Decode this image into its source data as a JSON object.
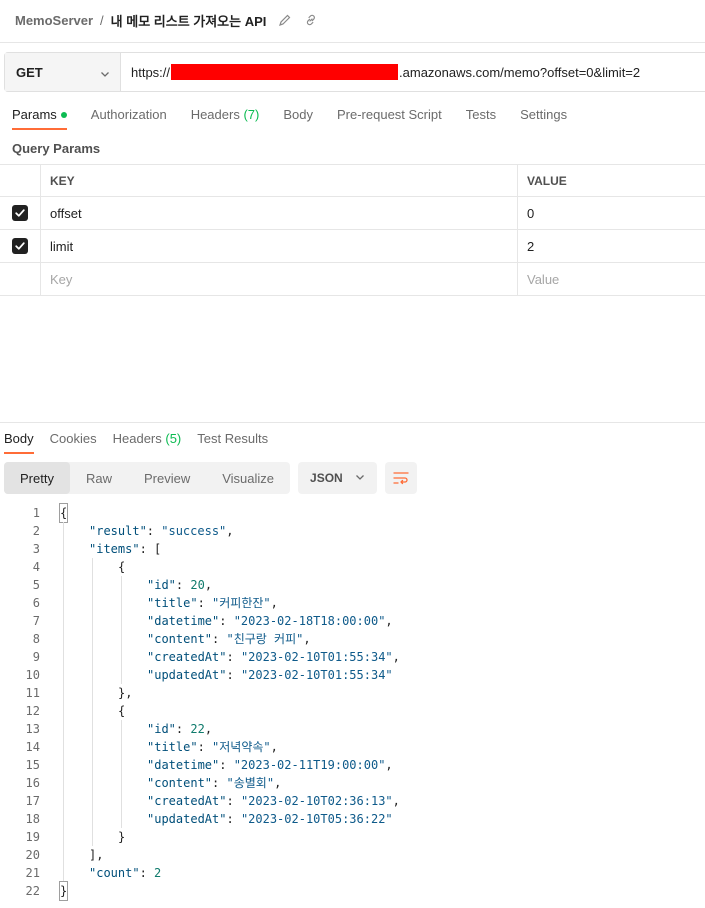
{
  "breadcrumb": {
    "collection": "MemoServer",
    "separator": "/",
    "request": "내 메모 리스트 가져오는 API"
  },
  "request": {
    "method": "GET",
    "url_prefix": "https://",
    "url_suffix": ".amazonaws.com/memo?offset=0&limit=2"
  },
  "request_tabs": [
    {
      "name": "params",
      "label": "Params",
      "count": "",
      "dot": true,
      "active": true
    },
    {
      "name": "authorization",
      "label": "Authorization",
      "count": "",
      "dot": false,
      "active": false
    },
    {
      "name": "headers",
      "label": "Headers",
      "count": "(7)",
      "dot": false,
      "active": false
    },
    {
      "name": "body",
      "label": "Body",
      "count": "",
      "dot": false,
      "active": false
    },
    {
      "name": "pre-request-script",
      "label": "Pre-request Script",
      "count": "",
      "dot": false,
      "active": false
    },
    {
      "name": "tests",
      "label": "Tests",
      "count": "",
      "dot": false,
      "active": false
    },
    {
      "name": "settings",
      "label": "Settings",
      "count": "",
      "dot": false,
      "active": false
    }
  ],
  "query_params": {
    "title": "Query Params",
    "headers": {
      "key": "KEY",
      "value": "VALUE"
    },
    "rows": [
      {
        "checked": true,
        "key": "offset",
        "value": "0"
      },
      {
        "checked": true,
        "key": "limit",
        "value": "2"
      }
    ],
    "placeholder": {
      "key": "Key",
      "value": "Value"
    }
  },
  "response_tabs": [
    {
      "name": "body",
      "label": "Body",
      "count": "",
      "active": true
    },
    {
      "name": "cookies",
      "label": "Cookies",
      "count": "",
      "active": false
    },
    {
      "name": "headers",
      "label": "Headers",
      "count": "(5)",
      "active": false
    },
    {
      "name": "test-results",
      "label": "Test Results",
      "count": "",
      "active": false
    }
  ],
  "view_modes": [
    {
      "name": "pretty",
      "label": "Pretty",
      "active": true
    },
    {
      "name": "raw",
      "label": "Raw",
      "active": false
    },
    {
      "name": "preview",
      "label": "Preview",
      "active": false
    },
    {
      "name": "visualize",
      "label": "Visualize",
      "active": false
    }
  ],
  "format": "JSON",
  "code_lines": [
    {
      "n": "1",
      "indent": 0,
      "parts": [
        [
          "p",
          "{"
        ]
      ]
    },
    {
      "n": "2",
      "indent": 1,
      "parts": [
        [
          "k",
          "\"result\""
        ],
        [
          "p",
          ": "
        ],
        [
          "s",
          "\"success\""
        ],
        [
          "p",
          ","
        ]
      ]
    },
    {
      "n": "3",
      "indent": 1,
      "parts": [
        [
          "k",
          "\"items\""
        ],
        [
          "p",
          ": ["
        ]
      ]
    },
    {
      "n": "4",
      "indent": 2,
      "parts": [
        [
          "p",
          "{"
        ]
      ]
    },
    {
      "n": "5",
      "indent": 3,
      "parts": [
        [
          "k",
          "\"id\""
        ],
        [
          "p",
          ": "
        ],
        [
          "n",
          "20"
        ],
        [
          "p",
          ","
        ]
      ]
    },
    {
      "n": "6",
      "indent": 3,
      "parts": [
        [
          "k",
          "\"title\""
        ],
        [
          "p",
          ": "
        ],
        [
          "s",
          "\"커피한잔\""
        ],
        [
          "p",
          ","
        ]
      ]
    },
    {
      "n": "7",
      "indent": 3,
      "parts": [
        [
          "k",
          "\"datetime\""
        ],
        [
          "p",
          ": "
        ],
        [
          "s",
          "\"2023-02-18T18:00:00\""
        ],
        [
          "p",
          ","
        ]
      ]
    },
    {
      "n": "8",
      "indent": 3,
      "parts": [
        [
          "k",
          "\"content\""
        ],
        [
          "p",
          ": "
        ],
        [
          "s",
          "\"친구랑 커피\""
        ],
        [
          "p",
          ","
        ]
      ]
    },
    {
      "n": "9",
      "indent": 3,
      "parts": [
        [
          "k",
          "\"createdAt\""
        ],
        [
          "p",
          ": "
        ],
        [
          "s",
          "\"2023-02-10T01:55:34\""
        ],
        [
          "p",
          ","
        ]
      ]
    },
    {
      "n": "10",
      "indent": 3,
      "parts": [
        [
          "k",
          "\"updatedAt\""
        ],
        [
          "p",
          ": "
        ],
        [
          "s",
          "\"2023-02-10T01:55:34\""
        ]
      ]
    },
    {
      "n": "11",
      "indent": 2,
      "parts": [
        [
          "p",
          "},"
        ]
      ]
    },
    {
      "n": "12",
      "indent": 2,
      "parts": [
        [
          "p",
          "{"
        ]
      ]
    },
    {
      "n": "13",
      "indent": 3,
      "parts": [
        [
          "k",
          "\"id\""
        ],
        [
          "p",
          ": "
        ],
        [
          "n",
          "22"
        ],
        [
          "p",
          ","
        ]
      ]
    },
    {
      "n": "14",
      "indent": 3,
      "parts": [
        [
          "k",
          "\"title\""
        ],
        [
          "p",
          ": "
        ],
        [
          "s",
          "\"저녁약속\""
        ],
        [
          "p",
          ","
        ]
      ]
    },
    {
      "n": "15",
      "indent": 3,
      "parts": [
        [
          "k",
          "\"datetime\""
        ],
        [
          "p",
          ": "
        ],
        [
          "s",
          "\"2023-02-11T19:00:00\""
        ],
        [
          "p",
          ","
        ]
      ]
    },
    {
      "n": "16",
      "indent": 3,
      "parts": [
        [
          "k",
          "\"content\""
        ],
        [
          "p",
          ": "
        ],
        [
          "s",
          "\"송별회\""
        ],
        [
          "p",
          ","
        ]
      ]
    },
    {
      "n": "17",
      "indent": 3,
      "parts": [
        [
          "k",
          "\"createdAt\""
        ],
        [
          "p",
          ": "
        ],
        [
          "s",
          "\"2023-02-10T02:36:13\""
        ],
        [
          "p",
          ","
        ]
      ]
    },
    {
      "n": "18",
      "indent": 3,
      "parts": [
        [
          "k",
          "\"updatedAt\""
        ],
        [
          "p",
          ": "
        ],
        [
          "s",
          "\"2023-02-10T05:36:22\""
        ]
      ]
    },
    {
      "n": "19",
      "indent": 2,
      "parts": [
        [
          "p",
          "}"
        ]
      ]
    },
    {
      "n": "20",
      "indent": 1,
      "parts": [
        [
          "p",
          "],"
        ]
      ]
    },
    {
      "n": "21",
      "indent": 1,
      "parts": [
        [
          "k",
          "\"count\""
        ],
        [
          "p",
          ": "
        ],
        [
          "n",
          "2"
        ]
      ]
    },
    {
      "n": "22",
      "indent": 0,
      "parts": [
        [
          "p",
          "}"
        ]
      ]
    }
  ],
  "colors": {
    "accent": "#ff6c37",
    "success": "#0cbb52",
    "redaction": "#ff0000"
  }
}
